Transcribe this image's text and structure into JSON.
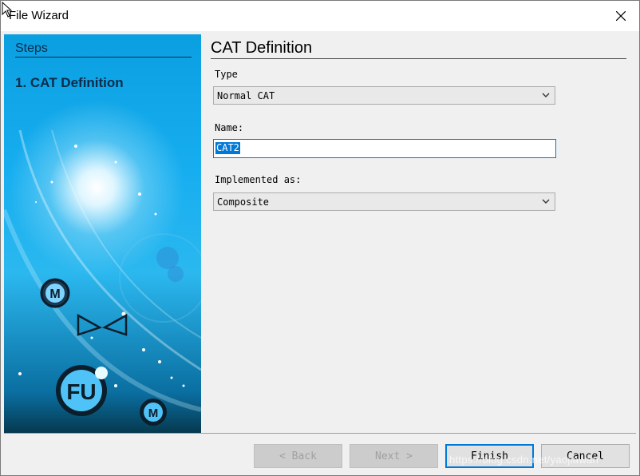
{
  "window": {
    "title": "File Wizard"
  },
  "steps": {
    "heading": "Steps",
    "items": [
      "1. CAT Definition"
    ]
  },
  "page": {
    "title": "CAT Definition"
  },
  "form": {
    "type_label": "Type",
    "type_value": "Normal CAT",
    "name_label": "Name:",
    "name_value": "CAT2",
    "impl_label": "Implemented as:",
    "impl_value": "Composite"
  },
  "buttons": {
    "back": "< Back",
    "next": "Next >",
    "finish": "Finish",
    "cancel": "Cancel"
  },
  "art": {
    "badge_m1": "M",
    "badge_fu": "FU",
    "badge_m2": "M"
  },
  "watermark": "https://blog.csdn.net/yaojiawan",
  "colors": {
    "accent": "#0078d7",
    "panel_blue": "#17aef0"
  }
}
